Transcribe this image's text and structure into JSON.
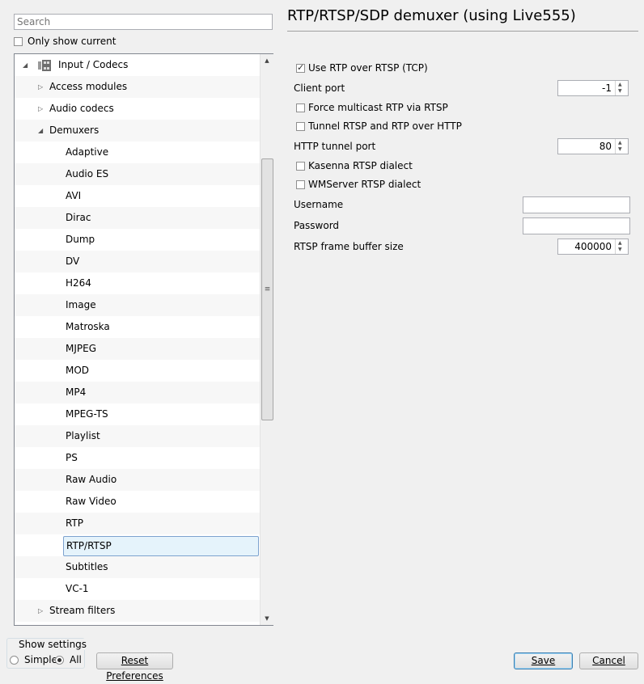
{
  "search": {
    "placeholder": "Search",
    "value": ""
  },
  "only_show_current": {
    "label": "Only show current",
    "checked": false
  },
  "tree": {
    "root": {
      "label": "Input / Codecs",
      "icon": "codec-icon",
      "expanded": true
    },
    "items": [
      {
        "label": "Access modules",
        "level": 1,
        "arrow": "collapsed"
      },
      {
        "label": "Audio codecs",
        "level": 1,
        "arrow": "collapsed"
      },
      {
        "label": "Demuxers",
        "level": 1,
        "arrow": "expanded"
      },
      {
        "label": "Adaptive",
        "level": 2
      },
      {
        "label": "Audio ES",
        "level": 2
      },
      {
        "label": "AVI",
        "level": 2
      },
      {
        "label": "Dirac",
        "level": 2
      },
      {
        "label": "Dump",
        "level": 2
      },
      {
        "label": "DV",
        "level": 2
      },
      {
        "label": "H264",
        "level": 2
      },
      {
        "label": "Image",
        "level": 2
      },
      {
        "label": "Matroska",
        "level": 2
      },
      {
        "label": "MJPEG",
        "level": 2
      },
      {
        "label": "MOD",
        "level": 2
      },
      {
        "label": "MP4",
        "level": 2
      },
      {
        "label": "MPEG-TS",
        "level": 2
      },
      {
        "label": "Playlist",
        "level": 2
      },
      {
        "label": "PS",
        "level": 2
      },
      {
        "label": "Raw Audio",
        "level": 2
      },
      {
        "label": "Raw Video",
        "level": 2
      },
      {
        "label": "RTP",
        "level": 2
      },
      {
        "label": "RTP/RTSP",
        "level": 2,
        "selected": true
      },
      {
        "label": "Subtitles",
        "level": 2
      },
      {
        "label": "VC-1",
        "level": 2
      },
      {
        "label": "Stream filters",
        "level": 1,
        "arrow": "collapsed"
      }
    ]
  },
  "panel": {
    "title": "RTP/RTSP/SDP demuxer (using Live555)",
    "use_rtp_over_rtsp": {
      "label": "Use RTP over RTSP (TCP)",
      "checked": true
    },
    "client_port": {
      "label": "Client port",
      "value": "-1"
    },
    "force_multicast": {
      "label": "Force multicast RTP via RTSP",
      "checked": false
    },
    "tunnel_rtsp": {
      "label": "Tunnel RTSP and RTP over HTTP",
      "checked": false
    },
    "http_tunnel_port": {
      "label": "HTTP tunnel port",
      "value": "80"
    },
    "kasenna": {
      "label": "Kasenna RTSP dialect",
      "checked": false
    },
    "wmserver": {
      "label": "WMServer RTSP dialect",
      "checked": false
    },
    "username": {
      "label": "Username",
      "value": ""
    },
    "password": {
      "label": "Password",
      "value": ""
    },
    "frame_buffer": {
      "label": "RTSP frame buffer size",
      "value": "400000"
    }
  },
  "show_settings": {
    "legend": "Show settings",
    "simple_label": "Simple",
    "all_label": "All",
    "selected": "All"
  },
  "buttons": {
    "reset": "Reset Preferences",
    "save": "Save",
    "cancel": "Cancel"
  }
}
